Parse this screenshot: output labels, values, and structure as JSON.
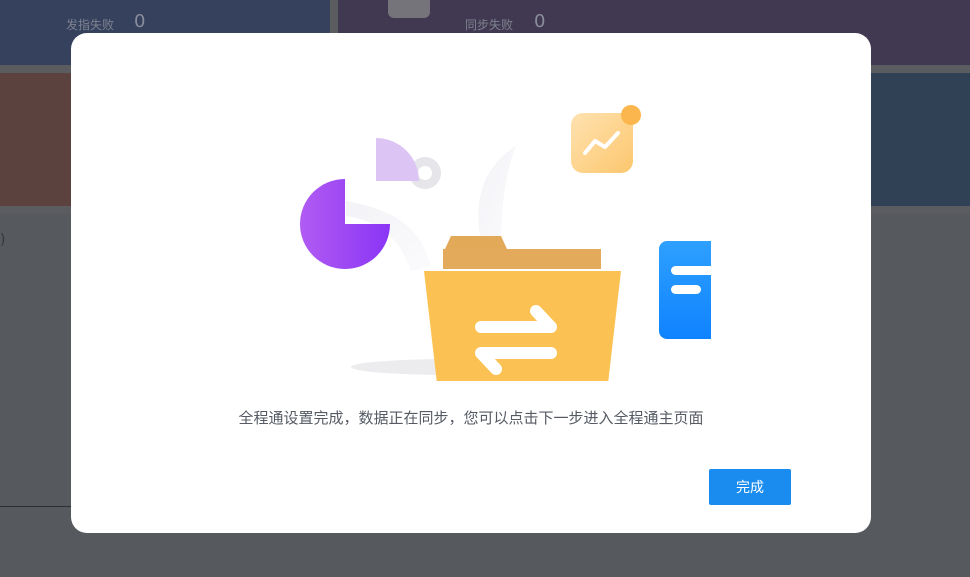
{
  "background": {
    "cards": [
      {
        "label": "发指失败",
        "value": "0"
      },
      {
        "label": "同步失败",
        "value": "0"
      }
    ],
    "bracket": ")"
  },
  "modal": {
    "message": "全程通设置完成，数据正在同步，您可以点击下一步进入全程通主页面",
    "done_label": "完成"
  },
  "colors": {
    "accent": "#1a8cf0",
    "folder": "#fbc253",
    "pie": "#a64bf4",
    "document": "#1d91ff"
  }
}
